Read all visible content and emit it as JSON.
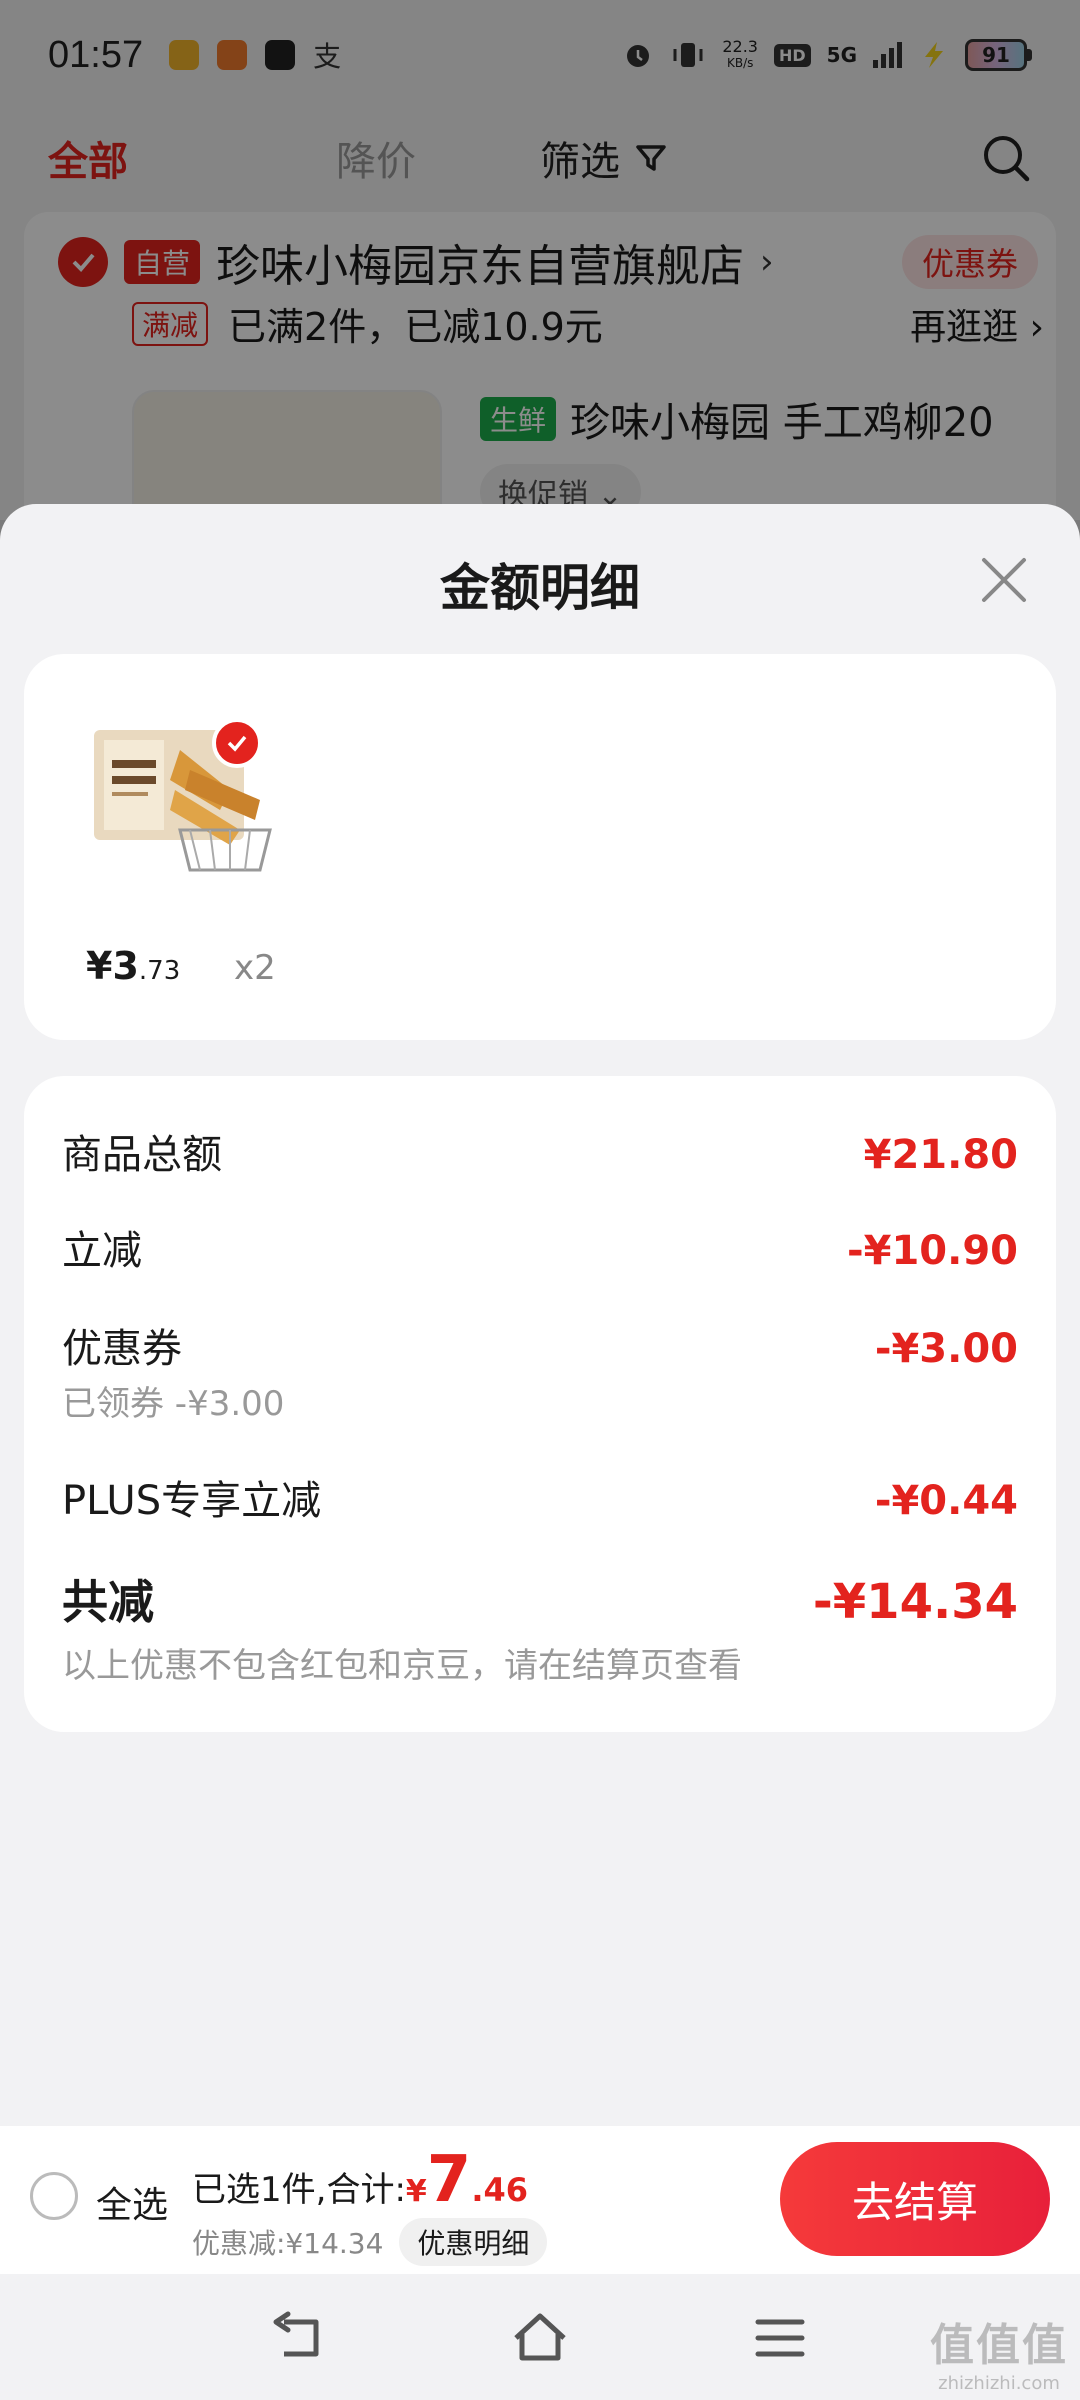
{
  "status_bar": {
    "time": "01:57",
    "net_speed_value": "22.3",
    "net_speed_unit": "KB/s",
    "hd_label": "HD",
    "network": "5G",
    "battery": "91"
  },
  "top_tabs": {
    "all": "全部",
    "price_drop": "降价",
    "filter": "筛选"
  },
  "store": {
    "self_tag": "自营",
    "name": "珍味小梅园京东自营旗舰店",
    "coupon_label": "优惠券",
    "promo_tag": "满减",
    "promo_text": "已满2件，已减10.9元",
    "promo_more": "再逛逛"
  },
  "product_bg": {
    "fresh_tag": "生鲜",
    "title": "珍味小梅园 手工鸡柳20",
    "swap_label": "换促销"
  },
  "sheet": {
    "title": "金额明细",
    "item": {
      "price_int": "¥3",
      "price_dec": ".73",
      "qty": "x2"
    },
    "rows": {
      "goods_total_label": "商品总额",
      "goods_total_value": "¥21.80",
      "instant_cut_label": "立减",
      "instant_cut_value": "-¥10.90",
      "coupon_label": "优惠券",
      "coupon_value": "-¥3.00",
      "coupon_sub": "已领券 -¥3.00",
      "plus_label": "PLUS专享立减",
      "plus_value": "-¥0.44",
      "total_cut_label": "共减",
      "total_cut_value": "-¥14.34",
      "note": "以上优惠不包含红包和京豆，请在结算页查看"
    }
  },
  "checkout": {
    "select_all": "全选",
    "selected_text": "已选1件,合计:",
    "yen": "¥",
    "total_int": "7",
    "total_dec": ".46",
    "saved_text": "优惠减:¥14.34",
    "detail_pill": "优惠明细",
    "checkout_button": "去结算"
  },
  "watermark": {
    "logo": "值值值",
    "url": "zhizhizhi.com"
  },
  "colors": {
    "accent": "#e3231e",
    "fresh": "#1cae4c"
  }
}
